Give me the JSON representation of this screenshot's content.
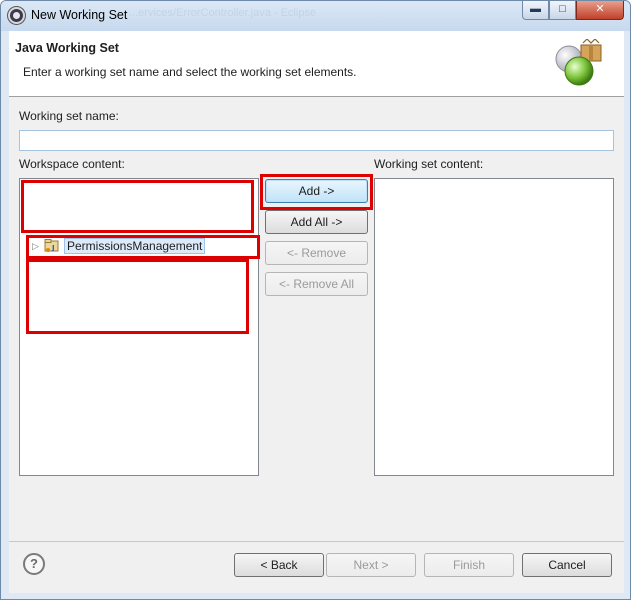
{
  "window": {
    "title": "New Working Set",
    "ghost_title": "...ervices/ErrorController.java - Eclipse",
    "minimize_glyph": "▬",
    "maximize_glyph": "□",
    "close_glyph": "✕"
  },
  "banner": {
    "title": "Java Working Set",
    "description": "Enter a working set name and select the working set elements."
  },
  "form": {
    "name_label": "Working set name:",
    "name_value": "",
    "workspace_label": "Workspace content:",
    "working_label": "Working set content:"
  },
  "workspace_tree": {
    "items": [
      {
        "label": "PermissionsManagement",
        "expanded": false,
        "selected": true
      }
    ]
  },
  "transfer_buttons": {
    "add": "Add ->",
    "add_all": "Add All ->",
    "remove": "<- Remove",
    "remove_all": "<- Remove All"
  },
  "footer": {
    "help_glyph": "?",
    "back": "< Back",
    "next": "Next >",
    "finish": "Finish",
    "cancel": "Cancel"
  },
  "colors": {
    "annotation_red": "#dc0000",
    "selection_bg": "#dceaf9",
    "close_button": "#c0402a"
  }
}
